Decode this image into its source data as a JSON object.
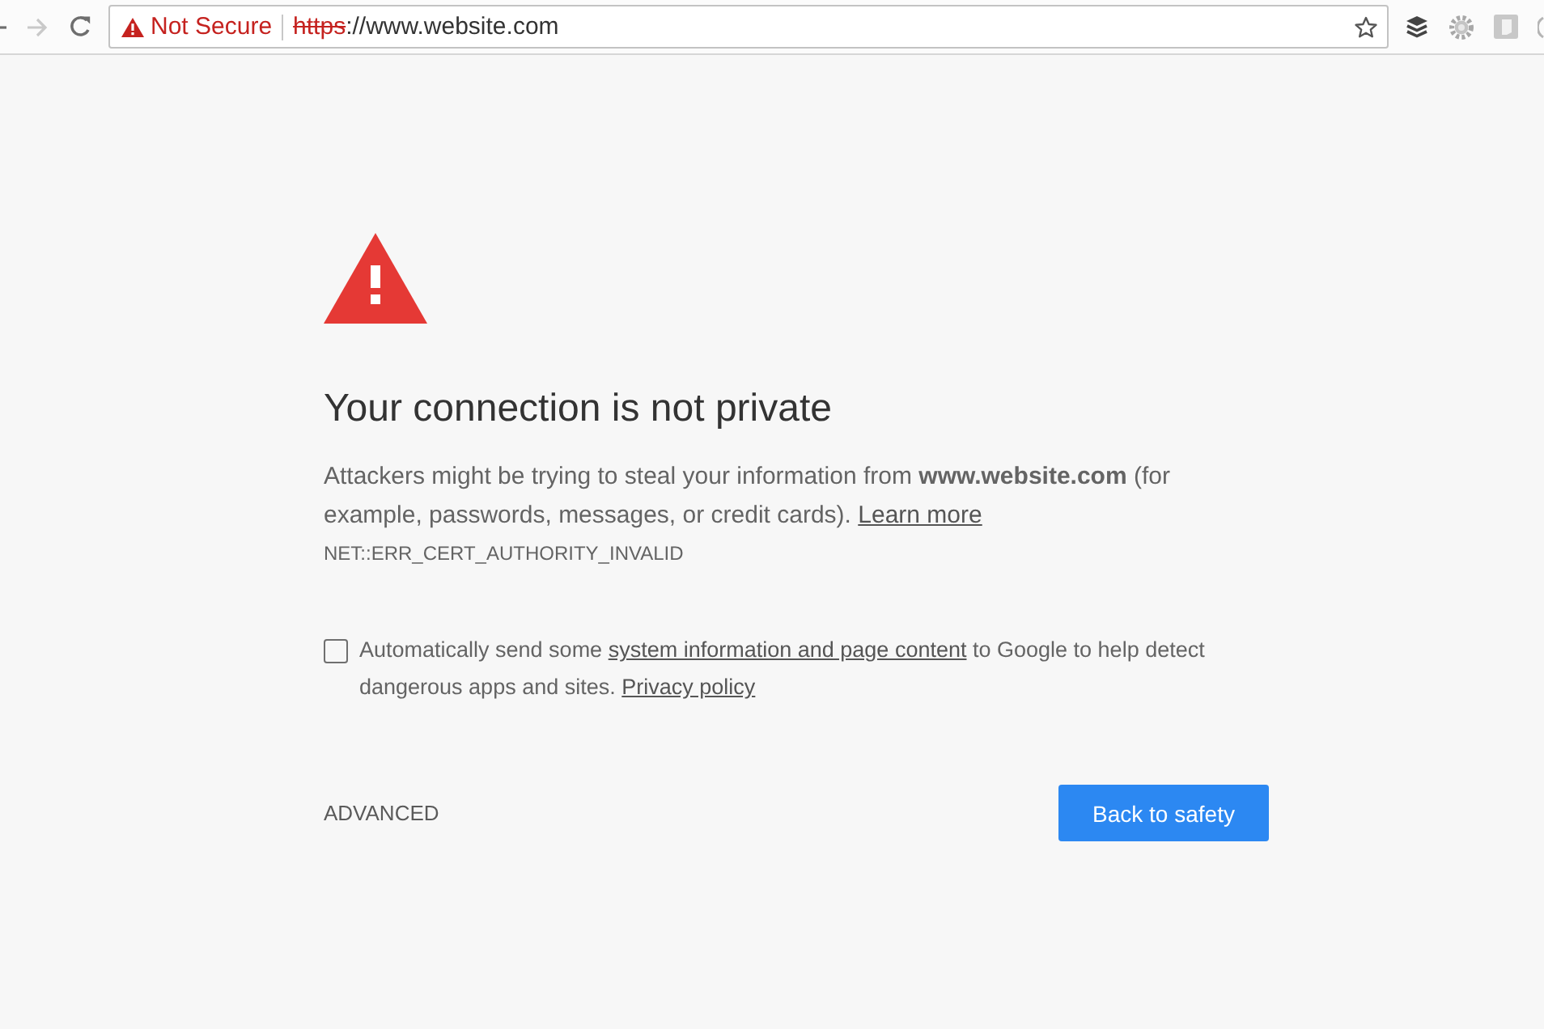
{
  "toolbar": {
    "nav_buttons": [
      {
        "kind": "back",
        "disabled": false
      },
      {
        "kind": "forward",
        "disabled": true
      },
      {
        "kind": "reload",
        "disabled": false
      }
    ]
  },
  "address_bar": {
    "security_label": "Not Secure",
    "scheme": "https",
    "rest": "://www.website.com",
    "bookmarked": false
  },
  "interstitial": {
    "heading": "Your connection is not private",
    "message": "Attackers might be trying to steal your information from **www.website.com** (for example, passwords, messages, or credit cards).",
    "learn_more": "Learn more",
    "error_code": "NET::ERR_CERT_AUTHORITY_INVALID",
    "report": {
      "checked": false,
      "text_before": "Automatically send some",
      "info_link": "system information and page content",
      "text_after": "to Google to help detect dangerous apps and sites.",
      "policy_link": "Privacy policy"
    },
    "advanced_button": "ADVANCED",
    "primary_button": "Back to safety"
  }
}
